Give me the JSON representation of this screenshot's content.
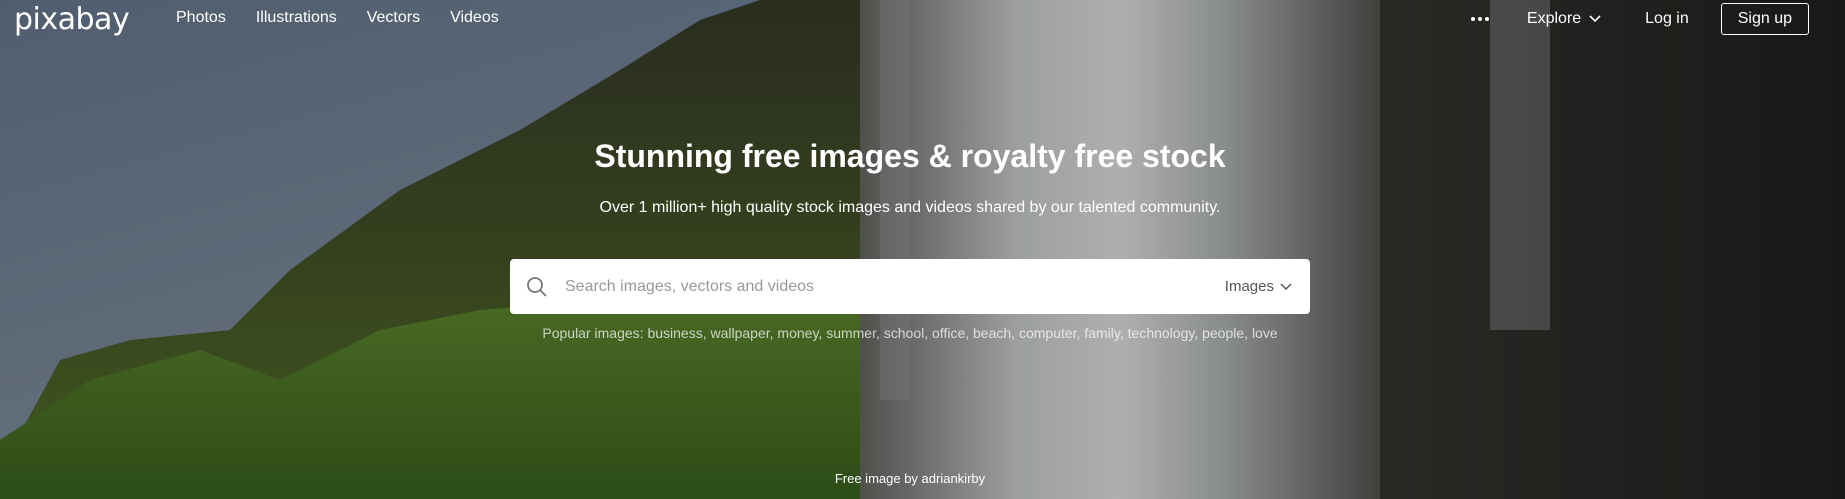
{
  "brand": {
    "logo_text": "pixabay"
  },
  "nav": {
    "links": [
      "Photos",
      "Illustrations",
      "Vectors",
      "Videos"
    ],
    "explore_label": "Explore",
    "login_label": "Log in",
    "signup_label": "Sign up"
  },
  "hero": {
    "headline": "Stunning free images & royalty free stock",
    "subline": "Over 1 million+ high quality stock images and videos shared by our talented community."
  },
  "search": {
    "placeholder": "Search images, vectors and videos",
    "type_label": "Images"
  },
  "popular": {
    "prefix": "Popular images:",
    "tags": [
      "business",
      "wallpaper",
      "money",
      "summer",
      "school",
      "office",
      "beach",
      "computer",
      "family",
      "technology",
      "people",
      "love"
    ]
  },
  "credit": {
    "text": "Free image by adriankirby"
  },
  "colors": {
    "text": "#ffffff",
    "search_bg": "#ffffff",
    "placeholder": "#999999"
  }
}
